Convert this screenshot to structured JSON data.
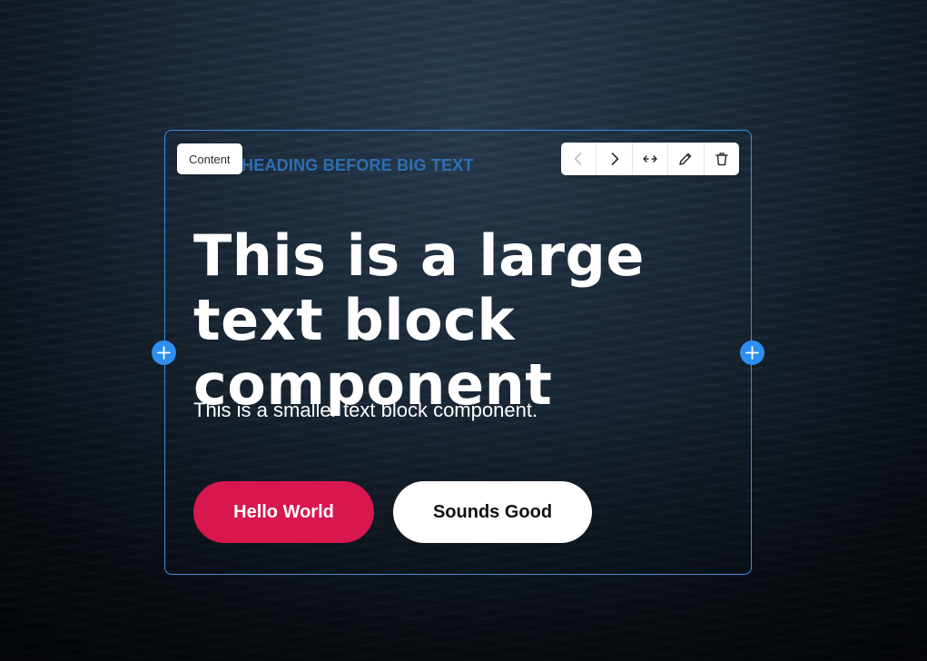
{
  "editor": {
    "content_tag": "Content",
    "toolbar": {
      "icons": [
        "chevron-left-icon",
        "chevron-right-icon",
        "resize-horizontal-icon",
        "pencil-icon",
        "trash-icon"
      ]
    },
    "accent_color": "#2d8ff0",
    "frame_color": "#3b8fe0"
  },
  "block": {
    "small_heading": "L HEADING BEFORE BIG TEXT",
    "big_text": "This is a large text block component",
    "small_text": "This is a smaller text block component.",
    "buttons": {
      "primary_label": "Hello World",
      "primary_color": "#d8174f",
      "secondary_label": "Sounds Good",
      "secondary_color": "#ffffff"
    }
  }
}
